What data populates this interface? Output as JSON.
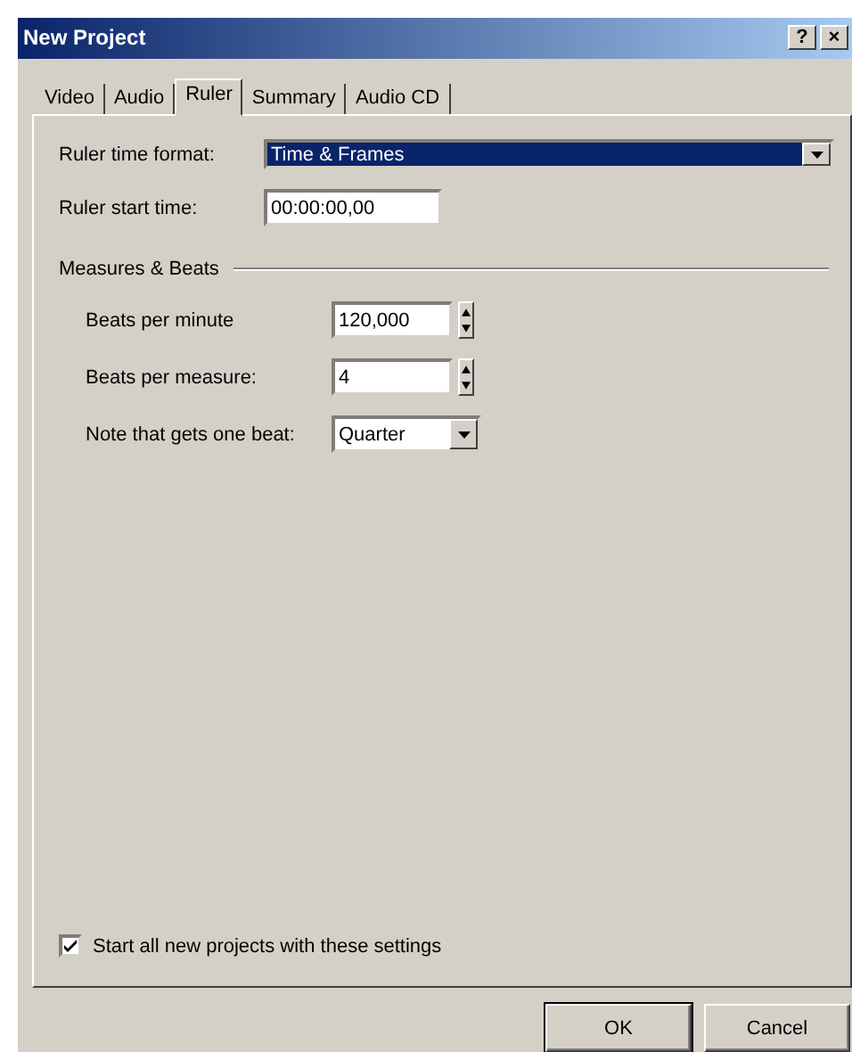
{
  "window": {
    "title": "New Project",
    "help_button": "?",
    "close_button": "×"
  },
  "tabs": [
    {
      "label": "Video",
      "selected": false
    },
    {
      "label": "Audio",
      "selected": false
    },
    {
      "label": "Ruler",
      "selected": true
    },
    {
      "label": "Summary",
      "selected": false
    },
    {
      "label": "Audio CD",
      "selected": false
    }
  ],
  "ruler_time_format": {
    "label": "Ruler time format:",
    "value": "Time & Frames",
    "focused": true
  },
  "ruler_start_time": {
    "label": "Ruler start time:",
    "value": "00:00:00,00"
  },
  "measures_group": {
    "title": "Measures & Beats",
    "fields": [
      {
        "kind": "spinner",
        "label": "Beats per minute",
        "value": "120,000"
      },
      {
        "kind": "spinner",
        "label": "Beats per measure:",
        "value": "4"
      },
      {
        "kind": "combo",
        "label": "Note that gets one beat:",
        "value": "Quarter"
      }
    ]
  },
  "start_checkbox": {
    "label": "Start all new projects with these settings",
    "checked": true
  },
  "buttons": [
    {
      "label": "OK",
      "default": true
    },
    {
      "label": "Cancel",
      "default": false
    }
  ]
}
